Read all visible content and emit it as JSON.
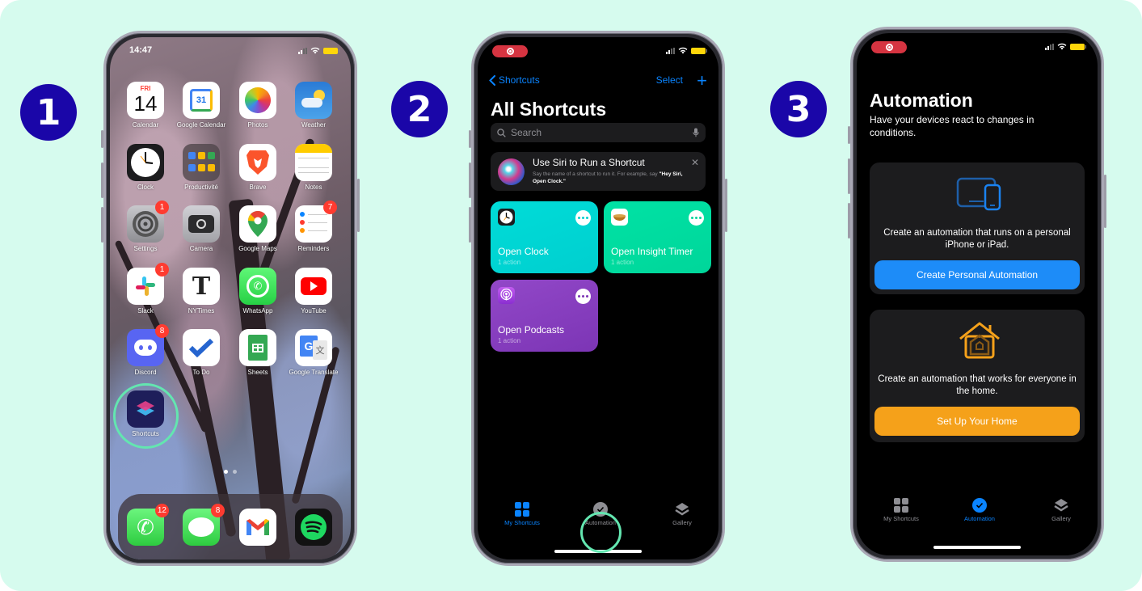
{
  "colors": {
    "background": "#d6fbee",
    "step_badge": "#1a06a8",
    "highlight_ring": "#63e6b0",
    "ios_blue": "#0a84ff",
    "ios_orange": "#f5a11a",
    "notification_red": "#ff3b30",
    "tile_clock": "#00d6d2",
    "tile_insight": "#00dea0",
    "tile_podcasts": "#8a3fc0"
  },
  "steps": [
    {
      "number": "1"
    },
    {
      "number": "2"
    },
    {
      "number": "3"
    }
  ],
  "phone1": {
    "time": "14:47",
    "apps": [
      {
        "label": "Calendar",
        "icon": "calendar-icon",
        "day": "FRI",
        "date": "14",
        "badge": null
      },
      {
        "label": "Google Calendar",
        "icon": "google-calendar-icon",
        "date": "31",
        "badge": null
      },
      {
        "label": "Photos",
        "icon": "photos-icon",
        "badge": null
      },
      {
        "label": "Weather",
        "icon": "weather-icon",
        "badge": null
      },
      {
        "label": "Clock",
        "icon": "clock-icon",
        "badge": null
      },
      {
        "label": "Productivité",
        "icon": "folder-icon",
        "badge": null
      },
      {
        "label": "Brave",
        "icon": "brave-icon",
        "badge": null
      },
      {
        "label": "Notes",
        "icon": "notes-icon",
        "badge": null
      },
      {
        "label": "Settings",
        "icon": "settings-icon",
        "badge": "1"
      },
      {
        "label": "Camera",
        "icon": "camera-icon",
        "badge": null
      },
      {
        "label": "Google Maps",
        "icon": "google-maps-icon",
        "badge": null
      },
      {
        "label": "Reminders",
        "icon": "reminders-icon",
        "badge": "7"
      },
      {
        "label": "Slack",
        "icon": "slack-icon",
        "badge": "1"
      },
      {
        "label": "NYTimes",
        "icon": "nytimes-icon",
        "badge": null
      },
      {
        "label": "WhatsApp",
        "icon": "whatsapp-icon",
        "badge": null
      },
      {
        "label": "YouTube",
        "icon": "youtube-icon",
        "badge": null
      },
      {
        "label": "Discord",
        "icon": "discord-icon",
        "badge": "8"
      },
      {
        "label": "To Do",
        "icon": "todo-icon",
        "badge": null
      },
      {
        "label": "Sheets",
        "icon": "sheets-icon",
        "badge": null
      },
      {
        "label": "Google Translate",
        "icon": "google-translate-icon",
        "badge": null
      },
      {
        "label": "Shortcuts",
        "icon": "shortcuts-icon",
        "badge": null
      }
    ],
    "dock": [
      {
        "label": "Phone",
        "icon": "phone-icon",
        "badge": "12"
      },
      {
        "label": "Messages",
        "icon": "messages-icon",
        "badge": "8"
      },
      {
        "label": "Gmail",
        "icon": "gmail-icon",
        "badge": null
      },
      {
        "label": "Spotify",
        "icon": "spotify-icon",
        "badge": null
      }
    ]
  },
  "phone2": {
    "back_label": "Shortcuts",
    "select_label": "Select",
    "add_label": "+",
    "title": "All Shortcuts",
    "search_placeholder": "Search",
    "siri_card": {
      "title": "Use Siri to Run a Shortcut",
      "body": "Say the name of a shortcut to run it. For example, say ",
      "example": "\"Hey Siri, Open Clock.\""
    },
    "shortcuts": [
      {
        "name": "Open Clock",
        "subtitle": "1 action"
      },
      {
        "name": "Open Insight Timer",
        "subtitle": "1 action"
      },
      {
        "name": "Open Podcasts",
        "subtitle": "1 action"
      }
    ],
    "tabs": [
      {
        "label": "My Shortcuts",
        "active": true
      },
      {
        "label": "Automation",
        "active": false
      },
      {
        "label": "Gallery",
        "active": false
      }
    ]
  },
  "phone3": {
    "title": "Automation",
    "subtitle": "Have your devices react to changes in conditions.",
    "personal_card": {
      "description": "Create an automation that runs on a personal iPhone or iPad.",
      "button": "Create Personal Automation"
    },
    "home_card": {
      "description": "Create an automation that works for everyone in the home.",
      "button": "Set Up Your Home"
    },
    "tabs": [
      {
        "label": "My Shortcuts",
        "active": false
      },
      {
        "label": "Automation",
        "active": true
      },
      {
        "label": "Gallery",
        "active": false
      }
    ]
  }
}
